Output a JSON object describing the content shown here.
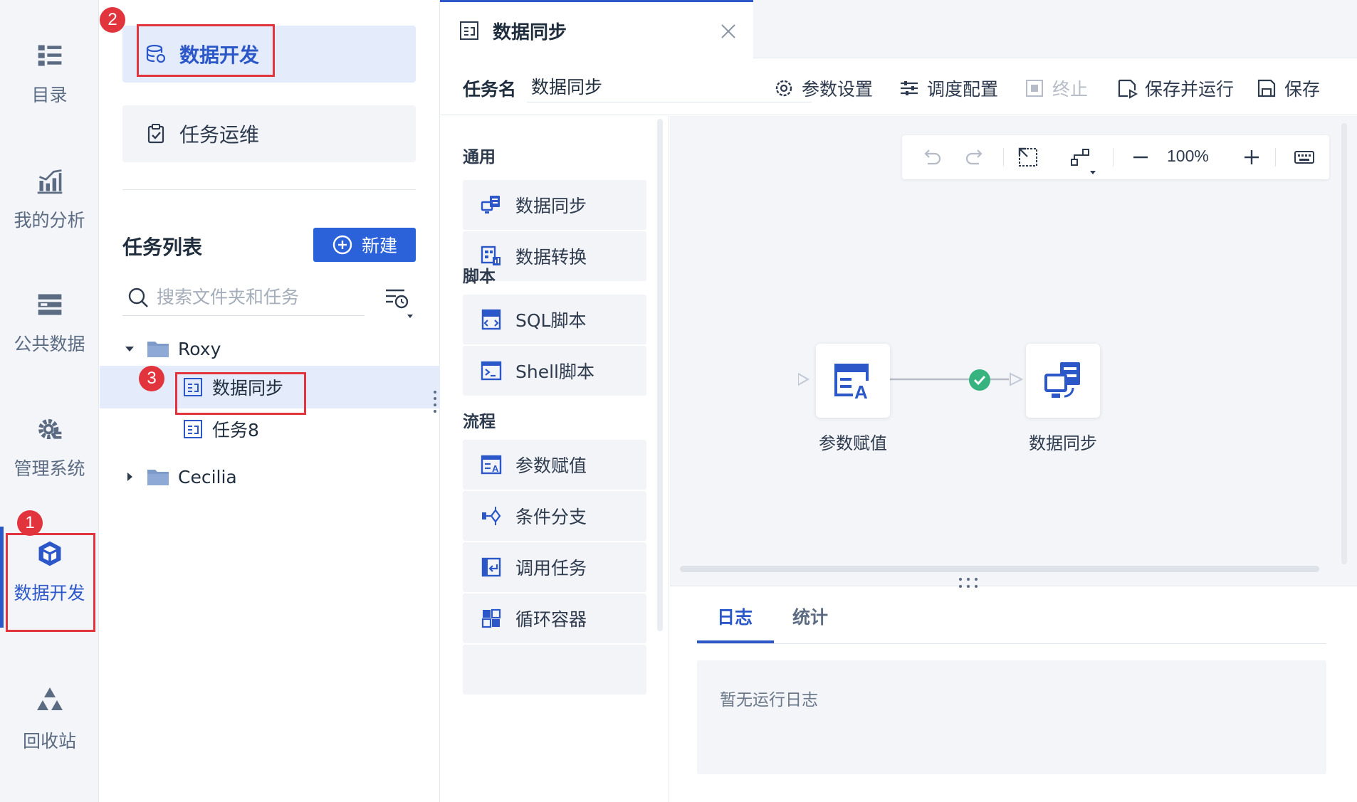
{
  "rail": {
    "items": [
      {
        "label": "目录",
        "icon": "catalog-icon"
      },
      {
        "label": "我的分析",
        "icon": "analysis-icon"
      },
      {
        "label": "公共数据",
        "icon": "public-data-icon"
      },
      {
        "label": "管理系统",
        "icon": "gear-icon"
      },
      {
        "label": "数据开发",
        "icon": "cube-icon"
      },
      {
        "label": "回收站",
        "icon": "recycle-icon"
      }
    ],
    "active_index": 4
  },
  "annotations": {
    "badge1": "1",
    "badge2": "2",
    "badge3": "3"
  },
  "panel": {
    "nav": [
      {
        "label": "数据开发",
        "icon": "database-icon"
      },
      {
        "label": "任务运维",
        "icon": "clipboard-check-icon"
      }
    ],
    "list_title": "任务列表",
    "new_button": "新建",
    "search_placeholder": "搜索文件夹和任务",
    "tree": [
      {
        "label": "Roxy",
        "type": "folder",
        "expanded": true
      },
      {
        "label": "数据同步",
        "type": "task",
        "selected": true
      },
      {
        "label": "任务8",
        "type": "task"
      },
      {
        "label": "Cecilia",
        "type": "folder",
        "expanded": false
      }
    ]
  },
  "tab": {
    "title": "数据同步"
  },
  "toolbar": {
    "task_name_label": "任务名",
    "task_name_value": "数据同步",
    "actions": [
      {
        "label": "参数设置",
        "icon": "settings-icon",
        "enabled": true
      },
      {
        "label": "调度配置",
        "icon": "sliders-icon",
        "enabled": true
      },
      {
        "label": "终止",
        "icon": "stop-icon",
        "enabled": false
      },
      {
        "label": "保存并运行",
        "icon": "save-run-icon",
        "enabled": true
      },
      {
        "label": "保存",
        "icon": "save-icon",
        "enabled": true
      }
    ]
  },
  "library": {
    "sections": [
      {
        "title": "通用",
        "items": [
          {
            "label": "数据同步",
            "icon": "data-sync-icon"
          },
          {
            "label": "数据转换",
            "icon": "data-transform-icon"
          }
        ]
      },
      {
        "title": "脚本",
        "items": [
          {
            "label": "SQL脚本",
            "icon": "sql-icon"
          },
          {
            "label": "Shell脚本",
            "icon": "shell-icon"
          }
        ]
      },
      {
        "title": "流程",
        "items": [
          {
            "label": "参数赋值",
            "icon": "param-assign-icon"
          },
          {
            "label": "条件分支",
            "icon": "branch-icon"
          },
          {
            "label": "调用任务",
            "icon": "call-task-icon"
          },
          {
            "label": "循环容器",
            "icon": "loop-icon"
          }
        ]
      }
    ]
  },
  "canvas": {
    "zoom": "100%",
    "nodes": [
      {
        "label": "参数赋值",
        "icon": "param-assign-icon"
      },
      {
        "label": "数据同步",
        "icon": "data-sync-icon"
      }
    ],
    "edge_status": "success"
  },
  "logs": {
    "tabs": [
      "日志",
      "统计"
    ],
    "active_tab": 0,
    "empty_text": "暂无运行日志"
  },
  "colors": {
    "accent": "#2b57c9",
    "highlight": "#e2343c",
    "success": "#36b37e"
  }
}
